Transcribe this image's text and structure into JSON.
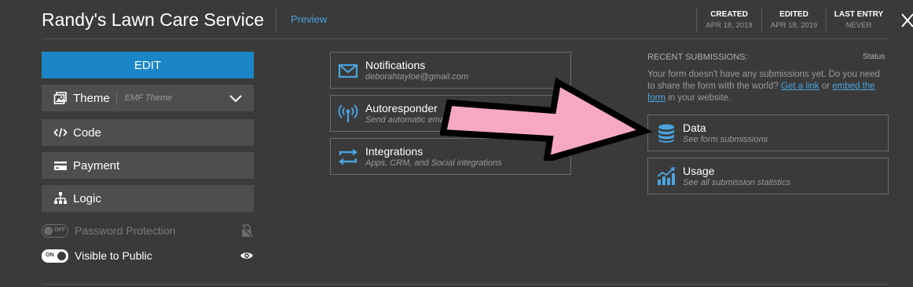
{
  "header": {
    "title": "Randy's Lawn Care Service",
    "preview": "Preview",
    "meta": [
      {
        "label": "CREATED",
        "value": "APR 18, 2019"
      },
      {
        "label": "EDITED",
        "value": "APR 18, 2019"
      },
      {
        "label": "LAST ENTRY",
        "value": "NEVER"
      }
    ]
  },
  "sidebar": {
    "edit_label": "EDIT",
    "theme": {
      "label": "Theme",
      "value": "EMF Theme"
    },
    "items": [
      {
        "label": "Code",
        "icon": "code-icon"
      },
      {
        "label": "Payment",
        "icon": "credit-card-icon"
      },
      {
        "label": "Logic",
        "icon": "sitemap-icon"
      }
    ],
    "password": {
      "label": "Password Protection",
      "toggle": "OFF"
    },
    "visible": {
      "label": "Visible to Public",
      "toggle": "ON"
    }
  },
  "actions": [
    {
      "title": "Notifications",
      "sub": "deborahtayloe@gmail.com",
      "icon": "envelope-icon"
    },
    {
      "title": "Autoresponder",
      "sub": "Send automatic emails",
      "icon": "broadcast-icon"
    },
    {
      "title": "Integrations",
      "sub": "Apps, CRM, and Social integrations",
      "icon": "sync-arrows-icon"
    }
  ],
  "recent": {
    "heading": "RECENT SUBMISSIONS:",
    "status": "Status",
    "text_before": "Your form doesn't have any submissions yet. Do you need to share the form with the world?",
    "link1": "Get a link",
    "text_mid": "or",
    "link2": "embed the form",
    "text_after": "in your website."
  },
  "data_cards": [
    {
      "title": "Data",
      "sub": "See form submissions",
      "icon": "database-icon"
    },
    {
      "title": "Usage",
      "sub": "See all submission statistics",
      "icon": "chart-icon"
    }
  ],
  "colors": {
    "background": "#3a3a3a",
    "accent": "#1a86c8",
    "link": "#4aa3df",
    "arrow_fill": "#f7a8c4"
  }
}
